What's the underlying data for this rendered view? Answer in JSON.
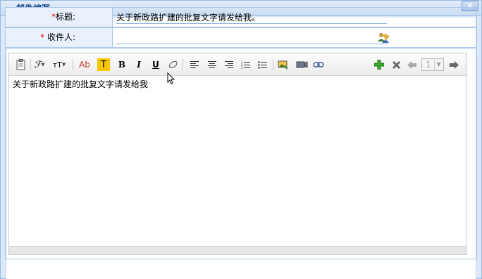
{
  "window": {
    "title": "邮件编写",
    "close_label": "×"
  },
  "form": {
    "subject": {
      "required_mark": "*",
      "label": "标题:",
      "value": "关于新政路扩建的批复文字请发给我。"
    },
    "recipient": {
      "required_mark": "*",
      "label": " 收件人:",
      "value": ""
    }
  },
  "editor": {
    "toolbar": {
      "bold_label": "B",
      "italic_label": "I",
      "underline_label": "U",
      "font_size_label": "ᴛT",
      "font_color_label": "Ab",
      "highlight_label": "T",
      "page_value": "1"
    },
    "content": "关于新政路扩建的批复文字请发给我"
  },
  "colors": {
    "accent": "#15428b",
    "border": "#a8c6ea",
    "label_bg": "#e9f1fc",
    "required": "#ff0000"
  }
}
